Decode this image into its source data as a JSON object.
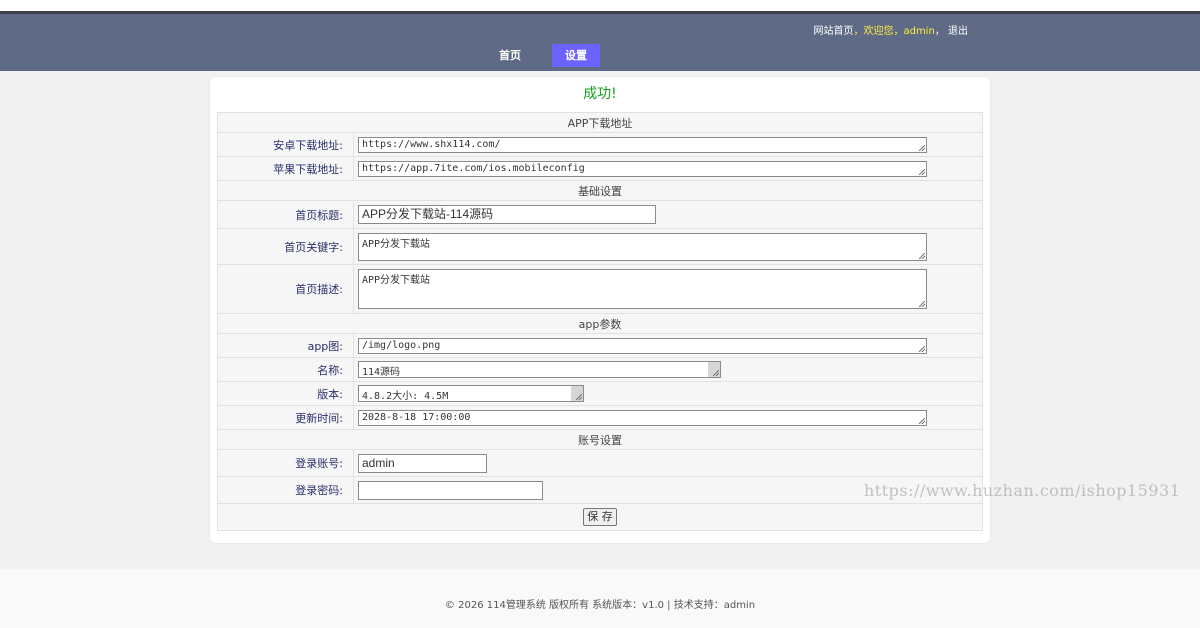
{
  "header": {
    "user_links": {
      "home": "网站首页",
      "sep1": "，",
      "welcome": "欢迎您",
      "sep2": "，",
      "username": "admin",
      "sep3": "，",
      "logout": "退出"
    },
    "nav": [
      {
        "label": "首页"
      },
      {
        "label": "设置",
        "active": true
      }
    ]
  },
  "message": "成功!",
  "sections": {
    "app_download": "APP下载地址",
    "basic": "基础设置",
    "app_params": "app参数",
    "account": "账号设置"
  },
  "fields": {
    "android_url": {
      "label": "安卓下载地址:",
      "value": "https://www.shx114.com/"
    },
    "ios_url": {
      "label": "苹果下载地址:",
      "value": "https://app.7ite.com/ios.mobileconfig"
    },
    "home_title": {
      "label": "首页标题:",
      "value": "APP分发下载站-114源码"
    },
    "home_keywords": {
      "label": "首页关键字:",
      "value": "APP分发下载站"
    },
    "home_desc": {
      "label": "首页描述:",
      "value": "APP分发下载站"
    },
    "app_icon": {
      "label": "app图:",
      "value": "/img/logo.png"
    },
    "app_name": {
      "label": "名称:",
      "value": "114源码"
    },
    "app_version": {
      "label": "版本:",
      "value": "4.8.2大小: 4.5M"
    },
    "update_time": {
      "label": "更新时间:",
      "value": "2028-8-18 17:00:00"
    },
    "login_account": {
      "label": "登录账号:",
      "value": "admin"
    },
    "login_password": {
      "label": "登录密码:",
      "value": ""
    }
  },
  "save_label": "保 存",
  "footer": "© 2026 114管理系统 版权所有 系统版本：v1.0 | 技术支持：admin",
  "watermark": "https://www.huzhan.com/ishop15931",
  "colors": {
    "header_bg": "#5f6b86",
    "nav_active": "#6b62ff",
    "success": "#14a21e",
    "highlight": "#ffec3d"
  }
}
